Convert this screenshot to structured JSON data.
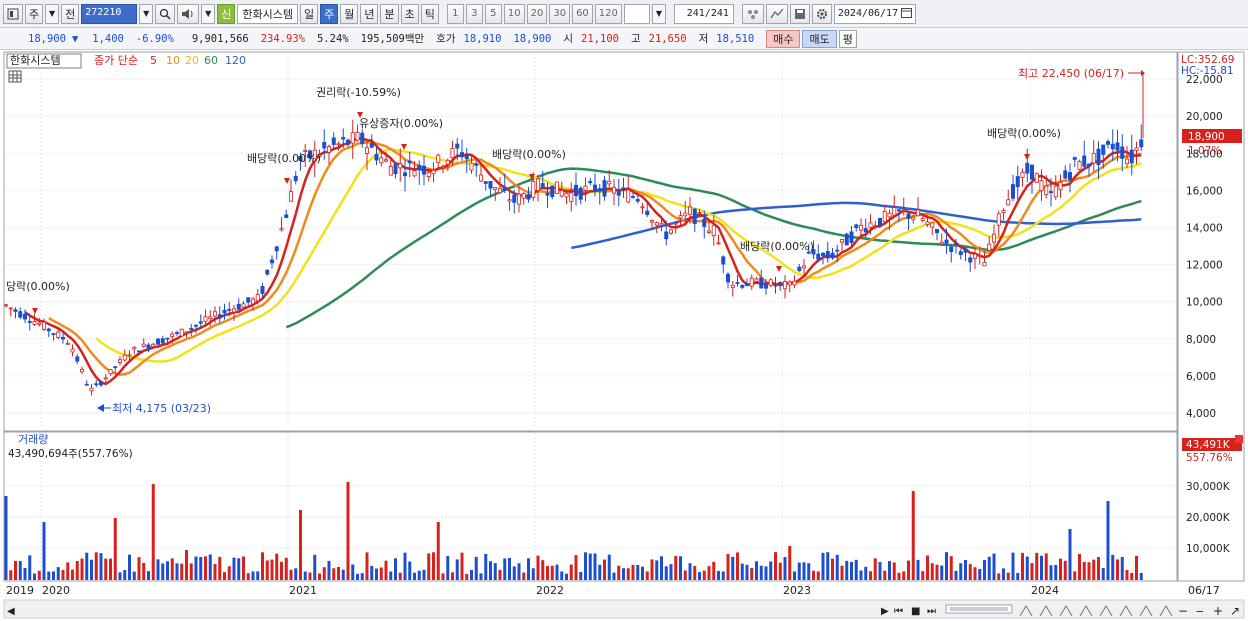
{
  "toolbar": {
    "market_btn": "주",
    "prev_btn": "전",
    "stock_code": "272210",
    "stock_name": "한화시스템",
    "credit_badge": "신",
    "periods": [
      "일",
      "주",
      "월",
      "년",
      "분",
      "초",
      "틱"
    ],
    "selected_period": "주",
    "intervals": [
      "1",
      "3",
      "5",
      "10",
      "20",
      "30",
      "60",
      "120"
    ],
    "count": "241",
    "count_total": "/241",
    "date": "2024/06/17"
  },
  "quote": {
    "price": "18,900",
    "change": "1,400",
    "change_pct": "-6.90%",
    "volume": "9,901,566",
    "vol_ratio": "234.93%",
    "turnover": "5.24%",
    "amount": "195,509백만",
    "bid_label": "호가",
    "ask": "18,910",
    "bid": "18,900",
    "open_label": "시",
    "open": "21,100",
    "high_label": "고",
    "high": "21,650",
    "low_label": "저",
    "low": "18,510",
    "buy_label": "매수",
    "sell_label": "매도",
    "pyeong_label": "평"
  },
  "legend": {
    "name": "한화시스템",
    "price_label": "종가 단순",
    "ma": [
      {
        "label": "5",
        "color": "#d6211c"
      },
      {
        "label": "10",
        "color": "#f08a1c"
      },
      {
        "label": "20",
        "color": "#e8d000"
      },
      {
        "label": "60",
        "color": "#2e8b57"
      },
      {
        "label": "120",
        "color": "#2f5fd0"
      }
    ]
  },
  "right_labels": {
    "lc": "LC:352.69",
    "hc": "HC:-15.81",
    "last_price": "18,900",
    "last_pct": "1.07%",
    "last_volume": "43,491K",
    "last_volume_pct": "557.76%"
  },
  "annotations": {
    "high": "최고 22,450 (06/17)",
    "low": "최저 4,175 (03/23)",
    "events": [
      "당락(0.00%)",
      "권리락(-10.59%)",
      "유상증자(0.00%)",
      "배당락(0.00%)",
      "배당락(0.00%)",
      "배당락(0.00%)",
      "배당락(0.00%)"
    ]
  },
  "volume_panel": {
    "title": "거래량",
    "value": "43,490,694주(557.76%)",
    "axis": [
      "30,000K",
      "20,000K",
      "10,000K"
    ]
  },
  "price_axis": [
    "22,000",
    "20,000",
    "18,000",
    "16,000",
    "14,000",
    "12,000",
    "10,000",
    "8,000",
    "6,000",
    "4,000"
  ],
  "x_axis": [
    "2019",
    "2020",
    "2021",
    "2022",
    "2023",
    "2024",
    "06/17"
  ],
  "colors": {
    "up": "#d6211c",
    "down": "#1b4fd0",
    "ma5": "#d6211c",
    "ma10": "#f08a1c",
    "ma20": "#f2e21a",
    "ma60": "#2e8b57",
    "ma120": "#2f5fd0"
  },
  "icons": [
    "chart-icon",
    "zoom-icon",
    "speaker-icon",
    "settings-icon",
    "save-icon",
    "calendar-icon"
  ]
}
